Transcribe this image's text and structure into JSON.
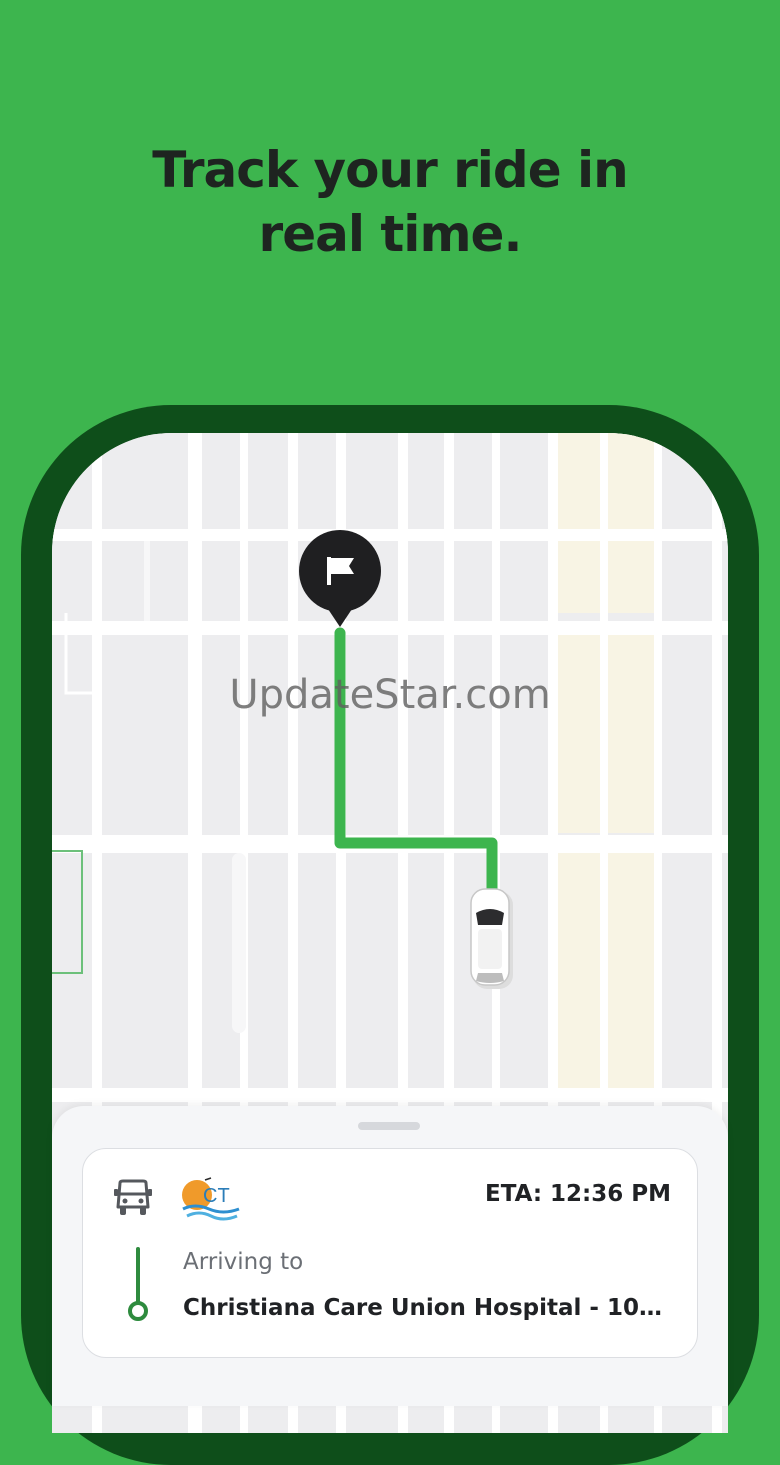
{
  "headline": {
    "line1": "Track your ride in",
    "line2": "real time."
  },
  "watermark": "UpdateStar.com",
  "map": {
    "destination_marker_icon": "flag-icon",
    "vehicle_icon": "car-icon",
    "route_color": "#3db54e"
  },
  "ride_card": {
    "vehicle_icon": "van-icon",
    "brand_logo_text": "CT",
    "eta": "ETA: 12:36 PM",
    "arriving_label": "Arriving to",
    "destination": "Christiana Care Union Hospital - 106 B..."
  },
  "colors": {
    "background": "#3db54e",
    "phone_frame": "#0e4e1a",
    "route_accent": "#2e8b3e",
    "text_dark": "#202225"
  }
}
